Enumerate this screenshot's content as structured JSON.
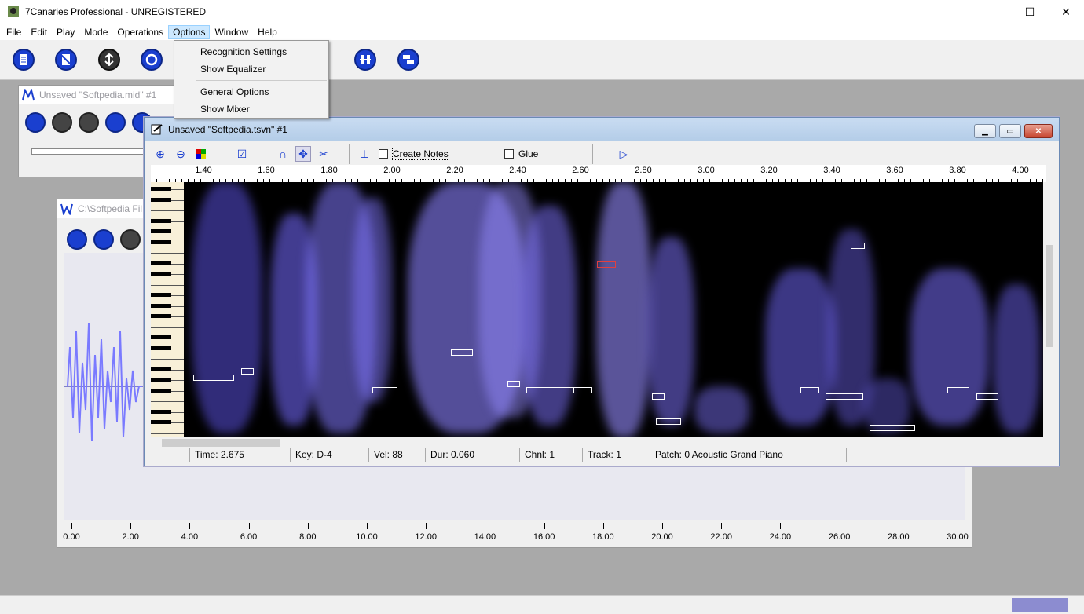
{
  "app": {
    "title": "7Canaries Professional - UNREGISTERED"
  },
  "window_controls": {
    "minimize": "—",
    "maximize": "☐",
    "close": "✕"
  },
  "menubar": {
    "items": [
      "File",
      "Edit",
      "Play",
      "Mode",
      "Operations",
      "Options",
      "Window",
      "Help"
    ],
    "active": "Options"
  },
  "options_menu": {
    "items": [
      "Recognition Settings",
      "Show Equalizer",
      "General Options",
      "Show Mixer"
    ]
  },
  "toolbar": {
    "icons": [
      "new-document-icon",
      "no-document-icon",
      "split-icon",
      "record-icon",
      "split-columns-icon",
      "stack-icon"
    ]
  },
  "midi_window": {
    "title": "Unsaved \"Softpedia.mid\" #1"
  },
  "wave_window": {
    "title": "C:\\Softpedia Fil",
    "ruler_labels": [
      "0.00",
      "2.00",
      "4.00",
      "6.00",
      "8.00",
      "10.00",
      "12.00",
      "14.00",
      "16.00",
      "18.00",
      "20.00",
      "22.00",
      "24.00",
      "26.00",
      "28.00",
      "30.00"
    ]
  },
  "tsvn_window": {
    "title": "Unsaved \"Softpedia.tsvn\" #1",
    "toolbar": {
      "create_notes_label": "Create Notes",
      "glue_label": "Glue",
      "create_notes_checked": false,
      "glue_checked": false
    },
    "ruler_labels": [
      "1.40",
      "1.60",
      "1.80",
      "2.00",
      "2.20",
      "2.40",
      "2.60",
      "2.80",
      "3.00",
      "3.20",
      "3.40",
      "3.60",
      "3.80",
      "4.00"
    ],
    "status": {
      "time": "Time: 2.675",
      "key": "Key: D-4",
      "vel": "Vel: 88",
      "dur": "Dur: 0.060",
      "chnl": "Chnl: 1",
      "track": "Track: 1",
      "patch": "Patch: 0 Acoustic Grand Piano"
    }
  },
  "colors": {
    "accent_blue": "#1a3fcf",
    "spectrogram_bg": "#000000",
    "spectrogram_band": "#7070ff",
    "note_outline": "#ffffff",
    "selected_note": "#e04040"
  }
}
